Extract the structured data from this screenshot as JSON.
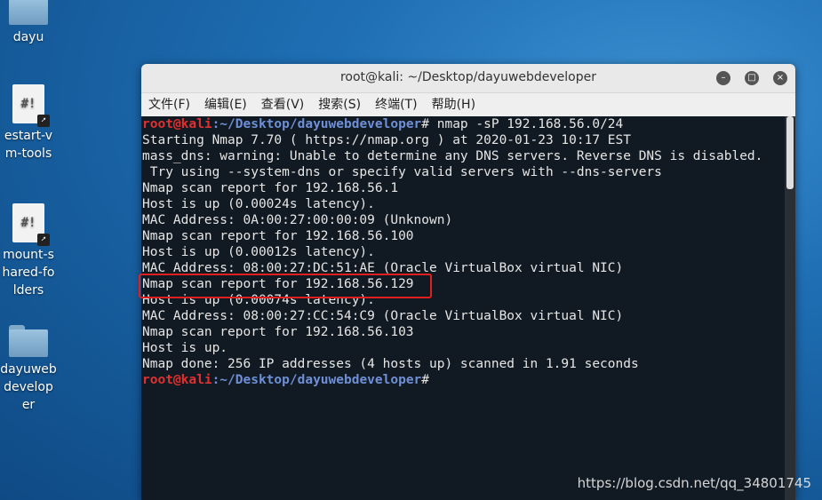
{
  "desktop": {
    "icons": [
      {
        "label": "dayu",
        "type": "folder"
      },
      {
        "label": "estart-vm-tools",
        "type": "script"
      },
      {
        "label": "mount-shared-folders",
        "type": "script"
      },
      {
        "label": "dayuwebdeveloper",
        "type": "folder"
      }
    ]
  },
  "window": {
    "title": "root@kali: ~/Desktop/dayuwebdeveloper",
    "menu": [
      "文件(F)",
      "编辑(E)",
      "查看(V)",
      "搜索(S)",
      "终端(T)",
      "帮助(H)"
    ],
    "controls": {
      "minimize": "–",
      "maximize": "□",
      "close": "×"
    }
  },
  "terminal": {
    "prompt_user": "root@kali",
    "prompt_path": ":~/Desktop/dayuwebdeveloper",
    "command": "# nmap -sP 192.168.56.0/24",
    "output": [
      "Starting Nmap 7.70 ( https://nmap.org ) at 2020-01-23 10:17 EST",
      "mass_dns: warning: Unable to determine any DNS servers. Reverse DNS is disabled.",
      " Try using --system-dns or specify valid servers with --dns-servers",
      "Nmap scan report for 192.168.56.1",
      "Host is up (0.00024s latency).",
      "MAC Address: 0A:00:27:00:00:09 (Unknown)",
      "Nmap scan report for 192.168.56.100",
      "Host is up (0.00012s latency).",
      "MAC Address: 08:00:27:DC:51:AE (Oracle VirtualBox virtual NIC)",
      "Nmap scan report for 192.168.56.129",
      "Host is up (0.00074s latency).",
      "MAC Address: 08:00:27:CC:54:C9 (Oracle VirtualBox virtual NIC)",
      "Nmap scan report for 192.168.56.103",
      "Host is up.",
      "Nmap done: 256 IP addresses (4 hosts up) scanned in 1.91 seconds"
    ],
    "final_prompt_suffix": "#"
  },
  "watermark": "https://blog.csdn.net/qq_34801745"
}
